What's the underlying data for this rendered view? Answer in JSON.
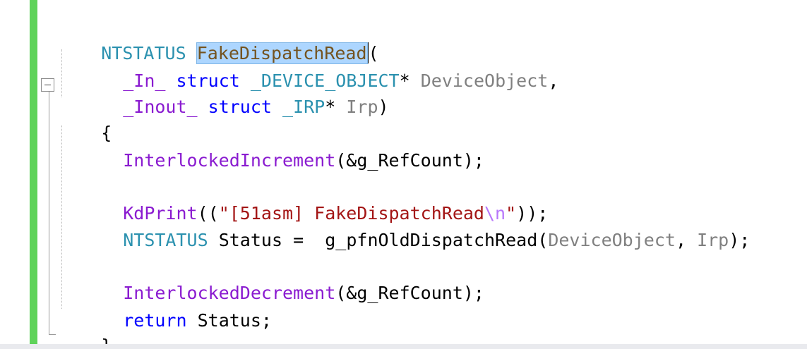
{
  "editor": {
    "colors": {
      "change_bar": "#5fd35a",
      "selection": "#add6ff",
      "type": "#2b91af",
      "keyword": "#0000ff",
      "function": "#74531f",
      "macro": "#8a1bd0",
      "parameter": "#808080",
      "string": "#a31515",
      "escape": "#b776fb"
    },
    "icons": {
      "collapse": "collapse-minus-icon"
    },
    "lines": [
      {
        "tokens": [
          "NTSTATUS",
          " ",
          "FakeDispatchRead",
          "("
        ]
      },
      {
        "tokens": [
          "_In_",
          " ",
          "struct",
          " ",
          "_DEVICE_OBJECT",
          "*",
          " ",
          "DeviceObject",
          ","
        ]
      },
      {
        "tokens": [
          "_Inout_",
          " ",
          "struct",
          " ",
          "_IRP",
          "*",
          " ",
          "Irp",
          ")"
        ]
      },
      {
        "tokens": [
          "{"
        ]
      },
      {
        "tokens": [
          "InterlockedIncrement",
          "(&",
          "g_RefCount",
          ");"
        ]
      },
      {
        "tokens": [
          "KdPrint",
          "((",
          "\"[51asm] FakeDispatchRead",
          "\\n",
          "\"",
          "));"
        ]
      },
      {
        "tokens": [
          "NTSTATUS",
          " ",
          "Status",
          " =  ",
          "g_pfnOldDispatchRead",
          "(",
          "DeviceObject",
          ", ",
          "Irp",
          ");"
        ]
      },
      {
        "tokens": [
          "InterlockedDecrement",
          "(&",
          "g_RefCount",
          ");"
        ]
      },
      {
        "tokens": [
          "return",
          " ",
          "Status",
          ";"
        ]
      },
      {
        "tokens": [
          "}"
        ]
      }
    ]
  }
}
